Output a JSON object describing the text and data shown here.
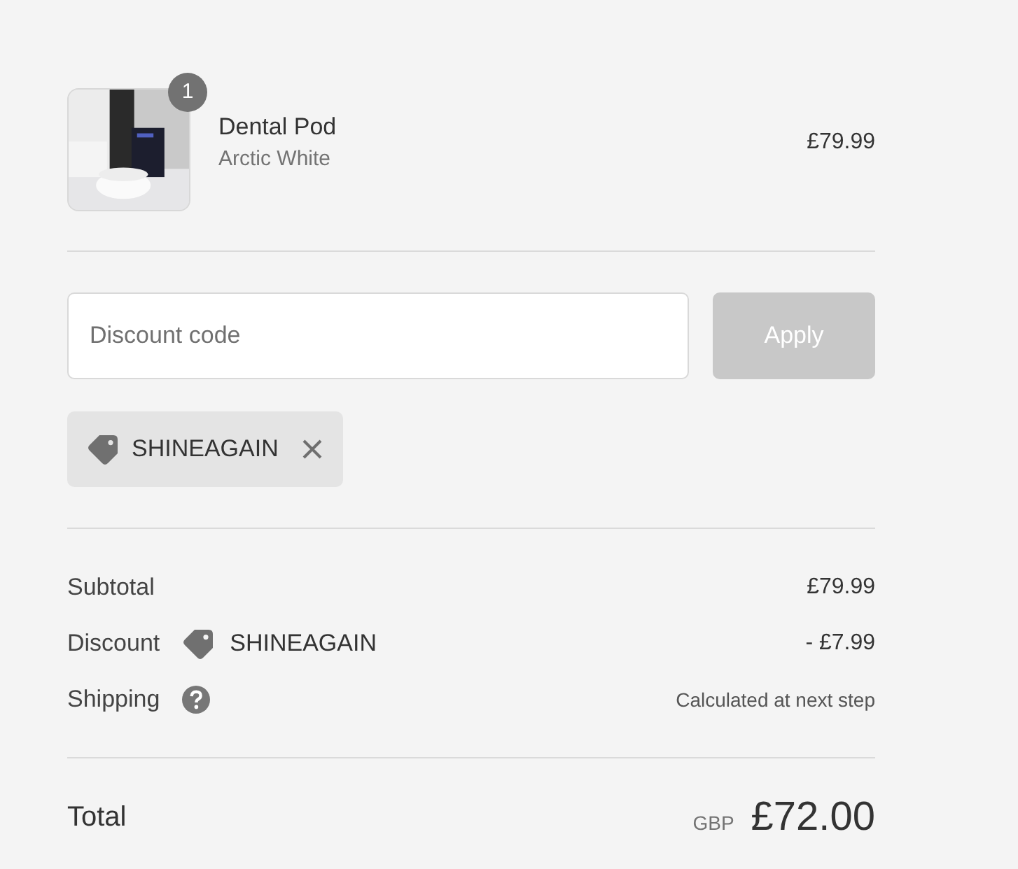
{
  "product": {
    "name": "Dental Pod",
    "variant": "Arctic White",
    "price": "£79.99",
    "quantity": "1"
  },
  "discount": {
    "placeholder": "Discount code",
    "button": "Apply",
    "button_disabled": true
  },
  "applied_codes": [
    {
      "code": "SHINEAGAIN"
    }
  ],
  "summary": [
    {
      "kind": "plain",
      "label": "Subtotal",
      "value": "£79.99"
    },
    {
      "kind": "discount",
      "label": "Discount",
      "code": "SHINEAGAIN",
      "value": "- £7.99"
    },
    {
      "kind": "shipping",
      "label": "Shipping",
      "value": "Calculated at next step"
    }
  ],
  "total": {
    "label": "Total",
    "currency": "GBP",
    "amount": "£72.00"
  }
}
